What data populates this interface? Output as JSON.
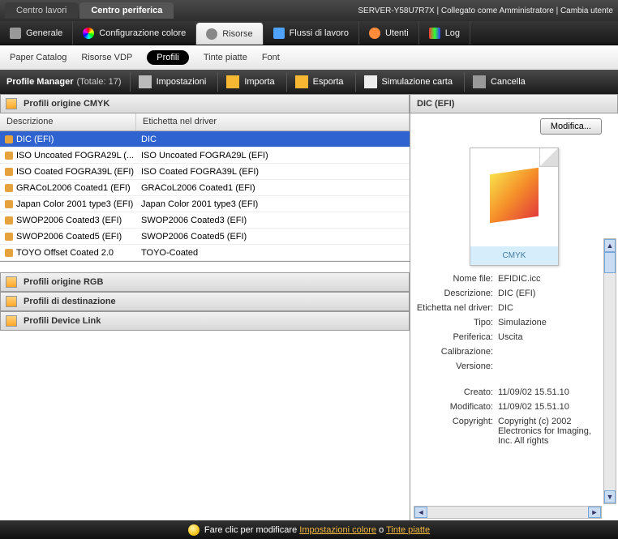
{
  "topbar": {
    "tabs": [
      {
        "label": "Centro lavori",
        "active": false
      },
      {
        "label": "Centro periferica",
        "active": true
      }
    ],
    "status": "SERVER-Y58U7R7X | Collegato come Amministratore | Cambia utente"
  },
  "navbar": {
    "items": [
      {
        "label": "Generale",
        "icon": "gear",
        "active": false
      },
      {
        "label": "Configurazione colore",
        "icon": "color",
        "active": false
      },
      {
        "label": "Risorse",
        "icon": "res",
        "active": true
      },
      {
        "label": "Flussi di lavoro",
        "icon": "flow",
        "active": false
      },
      {
        "label": "Utenti",
        "icon": "user",
        "active": false
      },
      {
        "label": "Log",
        "icon": "log",
        "active": false
      }
    ]
  },
  "subnav": {
    "items": [
      {
        "label": "Paper Catalog",
        "active": false
      },
      {
        "label": "Risorse VDP",
        "active": false
      },
      {
        "label": "Profili",
        "active": true
      },
      {
        "label": "Tinte piatte",
        "active": false
      },
      {
        "label": "Font",
        "active": false
      }
    ]
  },
  "toolbar": {
    "title": "Profile Manager",
    "count": "(Totale: 17)",
    "buttons": [
      {
        "label": "Impostazioni",
        "icon": "wrench"
      },
      {
        "label": "Importa",
        "icon": "import"
      },
      {
        "label": "Esporta",
        "icon": "export"
      },
      {
        "label": "Simulazione carta",
        "icon": "sim"
      },
      {
        "label": "Cancella",
        "icon": "del"
      }
    ]
  },
  "left": {
    "section_cmyk": "Profili origine CMYK",
    "columns": {
      "c1": "Descrizione",
      "c2": "Etichetta nel driver"
    },
    "rows": [
      {
        "c1": "DIC (EFI)",
        "c2": "DIC",
        "selected": true
      },
      {
        "c1": "ISO Uncoated FOGRA29L (...",
        "c2": "ISO Uncoated FOGRA29L (EFI)"
      },
      {
        "c1": "ISO Coated FOGRA39L (EFI)",
        "c2": "ISO Coated FOGRA39L (EFI)"
      },
      {
        "c1": "GRACoL2006 Coated1 (EFI)",
        "c2": "GRACoL2006 Coated1 (EFI)"
      },
      {
        "c1": "Japan Color 2001 type3 (EFI)",
        "c2": "Japan Color 2001 type3 (EFI)"
      },
      {
        "c1": "SWOP2006 Coated3 (EFI)",
        "c2": "SWOP2006 Coated3 (EFI)"
      },
      {
        "c1": "SWOP2006 Coated5 (EFI)",
        "c2": "SWOP2006 Coated5 (EFI)"
      },
      {
        "c1": "TOYO Offset Coated 2.0",
        "c2": "TOYO-Coated"
      }
    ],
    "section_rgb": "Profili origine RGB",
    "section_dest": "Profili di destinazione",
    "section_devicelink": "Profili Device Link"
  },
  "right": {
    "header": "DIC (EFI)",
    "modify_button": "Modifica...",
    "thumb_caption": "CMYK",
    "fields": {
      "nome_file_k": "Nome file:",
      "nome_file_v": "EFIDIC.icc",
      "descrizione_k": "Descrizione:",
      "descrizione_v": "DIC (EFI)",
      "etichetta_k": "Etichetta nel driver:",
      "etichetta_v": "DIC",
      "tipo_k": "Tipo:",
      "tipo_v": "Simulazione",
      "periferica_k": "Periferica:",
      "periferica_v": "Uscita",
      "calibrazione_k": "Calibrazione:",
      "calibrazione_v": "",
      "versione_k": "Versione:",
      "versione_v": "",
      "creato_k": "Creato:",
      "creato_v": "11/09/02 15.51.10",
      "modificato_k": "Modificato:",
      "modificato_v": "11/09/02 15.51.10",
      "copyright_k": "Copyright:",
      "copyright_v": "Copyright (c) 2002 Electronics for Imaging, Inc. All rights"
    }
  },
  "footer": {
    "pre": "Fare clic per modificare ",
    "link1": "Impostazioni colore",
    "mid": " o ",
    "link2": "Tinte piatte"
  }
}
